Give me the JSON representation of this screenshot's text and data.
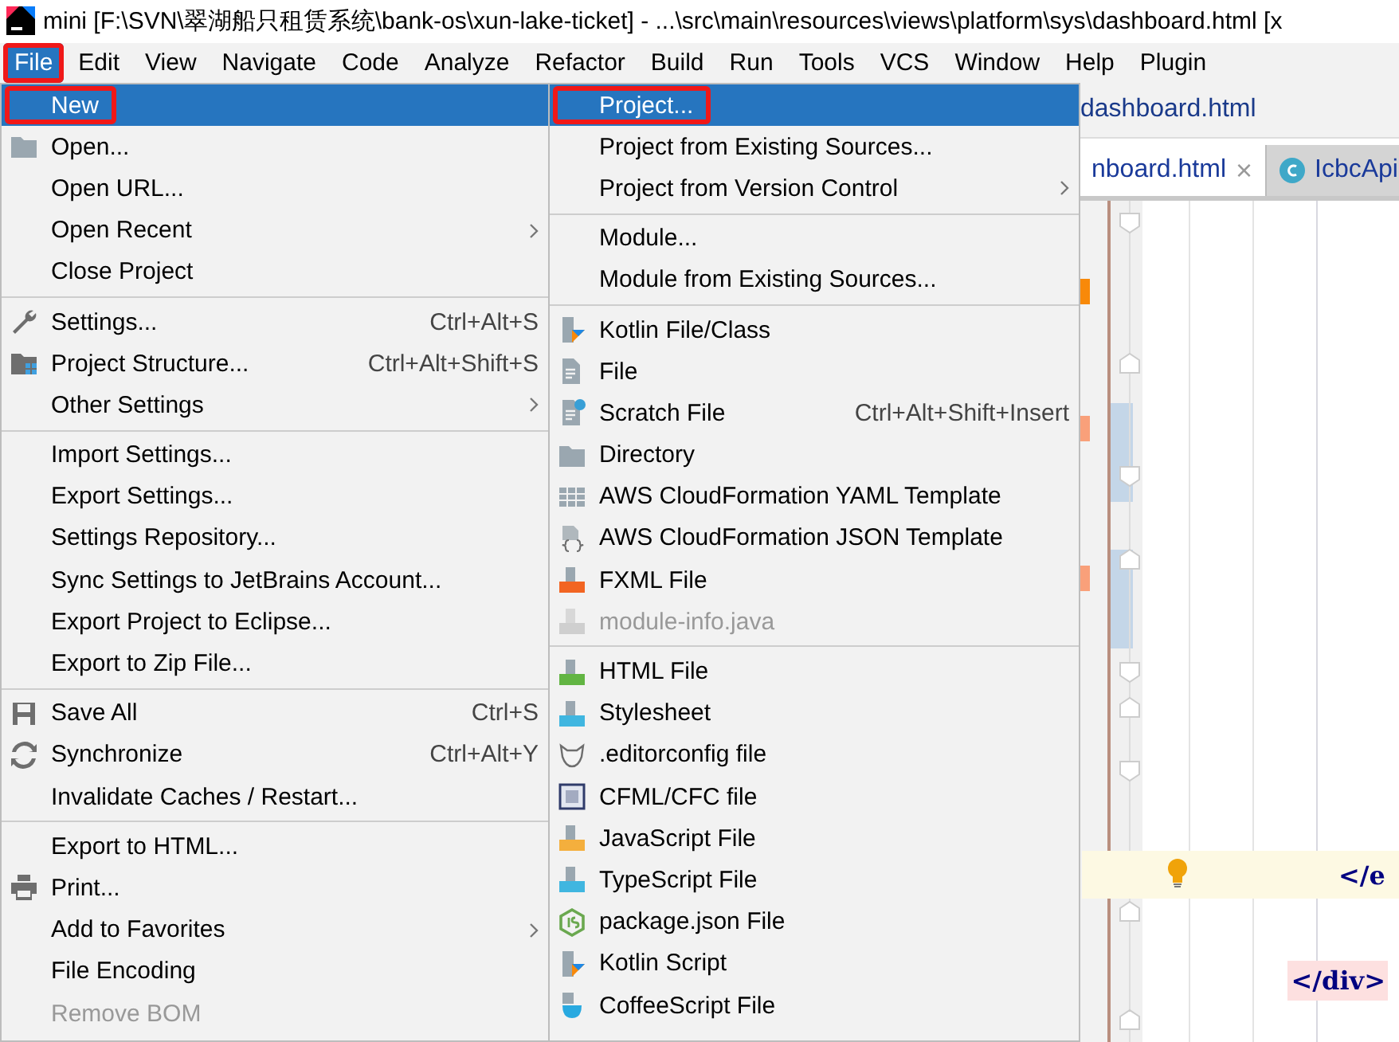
{
  "window": {
    "title": "mini [F:\\SVN\\翠湖船只租赁系统\\bank-os\\xun-lake-ticket] - ...\\src\\main\\resources\\views\\platform\\sys\\dashboard.html [x"
  },
  "menu_bar": [
    {
      "label": "File",
      "selected": true,
      "highlighted": true
    },
    {
      "label": "Edit",
      "selected": false,
      "highlighted": false
    },
    {
      "label": "View",
      "selected": false,
      "highlighted": false
    },
    {
      "label": "Navigate",
      "selected": false,
      "highlighted": false
    },
    {
      "label": "Code",
      "selected": false,
      "highlighted": false
    },
    {
      "label": "Analyze",
      "selected": false,
      "highlighted": false
    },
    {
      "label": "Refactor",
      "selected": false,
      "highlighted": false
    },
    {
      "label": "Build",
      "selected": false,
      "highlighted": false
    },
    {
      "label": "Run",
      "selected": false,
      "highlighted": false
    },
    {
      "label": "Tools",
      "selected": false,
      "highlighted": false
    },
    {
      "label": "VCS",
      "selected": false,
      "highlighted": false
    },
    {
      "label": "Window",
      "selected": false,
      "highlighted": false
    },
    {
      "label": "Help",
      "selected": false,
      "highlighted": false
    },
    {
      "label": "Plugin",
      "selected": false,
      "highlighted": false
    }
  ],
  "navigation_bar": {
    "file": "dashboard.html"
  },
  "editor_tabs": [
    {
      "label": "nboard.html",
      "close": "×",
      "selected": true
    },
    {
      "label": "IcbcApi",
      "selected": false
    }
  ],
  "editor": {
    "lines": [
      {
        "text": "</e",
        "current": true
      },
      {
        "text": "</div>",
        "current": false
      }
    ]
  },
  "file_menu": [
    {
      "kind": "item",
      "label": "New",
      "selected": true,
      "highlighted": true,
      "submenu": false,
      "disabled": false
    },
    {
      "kind": "item",
      "label": "Open...",
      "selected": false,
      "highlighted": false,
      "submenu": false,
      "disabled": false
    },
    {
      "kind": "item",
      "label": "Open URL...",
      "selected": false,
      "highlighted": false,
      "submenu": false,
      "disabled": false
    },
    {
      "kind": "item",
      "label": "Open Recent",
      "selected": false,
      "highlighted": false,
      "submenu": true,
      "disabled": false
    },
    {
      "kind": "item",
      "label": "Close Project",
      "selected": false,
      "highlighted": false,
      "submenu": false,
      "disabled": false
    },
    {
      "kind": "separator"
    },
    {
      "kind": "item",
      "label": "Settings...",
      "shortcut": "Ctrl+Alt+S",
      "selected": false,
      "highlighted": false,
      "submenu": false,
      "disabled": false
    },
    {
      "kind": "item",
      "label": "Project Structure...",
      "shortcut": "Ctrl+Alt+Shift+S",
      "selected": false,
      "highlighted": false,
      "submenu": false,
      "disabled": false
    },
    {
      "kind": "item",
      "label": "Other Settings",
      "selected": false,
      "highlighted": false,
      "submenu": true,
      "disabled": false
    },
    {
      "kind": "separator"
    },
    {
      "kind": "item",
      "label": "Import Settings...",
      "selected": false,
      "highlighted": false,
      "submenu": false,
      "disabled": false
    },
    {
      "kind": "item",
      "label": "Export Settings...",
      "selected": false,
      "highlighted": false,
      "submenu": false,
      "disabled": false
    },
    {
      "kind": "item",
      "label": "Settings Repository...",
      "selected": false,
      "highlighted": false,
      "submenu": false,
      "disabled": false
    },
    {
      "kind": "item",
      "label": "Sync Settings to JetBrains Account...",
      "selected": false,
      "highlighted": false,
      "submenu": false,
      "disabled": false
    },
    {
      "kind": "item",
      "label": "Export Project to Eclipse...",
      "selected": false,
      "highlighted": false,
      "submenu": false,
      "disabled": false
    },
    {
      "kind": "item",
      "label": "Export to Zip File...",
      "selected": false,
      "highlighted": false,
      "submenu": false,
      "disabled": false
    },
    {
      "kind": "separator"
    },
    {
      "kind": "item",
      "label": "Save All",
      "shortcut": "Ctrl+S",
      "selected": false,
      "highlighted": false,
      "submenu": false,
      "disabled": false
    },
    {
      "kind": "item",
      "label": "Synchronize",
      "shortcut": "Ctrl+Alt+Y",
      "selected": false,
      "highlighted": false,
      "submenu": false,
      "disabled": false
    },
    {
      "kind": "item",
      "label": "Invalidate Caches / Restart...",
      "selected": false,
      "highlighted": false,
      "submenu": false,
      "disabled": false
    },
    {
      "kind": "separator"
    },
    {
      "kind": "item",
      "label": "Export to HTML...",
      "selected": false,
      "highlighted": false,
      "submenu": false,
      "disabled": false
    },
    {
      "kind": "item",
      "label": "Print...",
      "selected": false,
      "highlighted": false,
      "submenu": false,
      "disabled": false
    },
    {
      "kind": "item",
      "label": "Add to Favorites",
      "selected": false,
      "highlighted": false,
      "submenu": true,
      "disabled": false
    },
    {
      "kind": "item",
      "label": "File Encoding",
      "selected": false,
      "highlighted": false,
      "submenu": false,
      "disabled": false
    },
    {
      "kind": "item",
      "label": "Remove BOM",
      "selected": false,
      "highlighted": false,
      "submenu": false,
      "disabled": true
    }
  ],
  "new_submenu": [
    {
      "kind": "item",
      "label": "Project...",
      "selected": true,
      "highlighted": true,
      "submenu": false,
      "disabled": false
    },
    {
      "kind": "item",
      "label": "Project from Existing Sources...",
      "selected": false,
      "highlighted": false,
      "submenu": false,
      "disabled": false
    },
    {
      "kind": "item",
      "label": "Project from Version Control",
      "selected": false,
      "highlighted": false,
      "submenu": true,
      "disabled": false
    },
    {
      "kind": "separator"
    },
    {
      "kind": "item",
      "label": "Module...",
      "selected": false,
      "highlighted": false,
      "submenu": false,
      "disabled": false
    },
    {
      "kind": "item",
      "label": "Module from Existing Sources...",
      "selected": false,
      "highlighted": false,
      "submenu": false,
      "disabled": false
    },
    {
      "kind": "separator"
    },
    {
      "kind": "item",
      "label": "Kotlin File/Class",
      "selected": false,
      "highlighted": false,
      "submenu": false,
      "disabled": false
    },
    {
      "kind": "item",
      "label": "File",
      "selected": false,
      "highlighted": false,
      "submenu": false,
      "disabled": false
    },
    {
      "kind": "item",
      "label": "Scratch File",
      "shortcut": "Ctrl+Alt+Shift+Insert",
      "selected": false,
      "highlighted": false,
      "submenu": false,
      "disabled": false
    },
    {
      "kind": "item",
      "label": "Directory",
      "selected": false,
      "highlighted": false,
      "submenu": false,
      "disabled": false
    },
    {
      "kind": "item",
      "label": "AWS CloudFormation YAML Template",
      "selected": false,
      "highlighted": false,
      "submenu": false,
      "disabled": false
    },
    {
      "kind": "item",
      "label": "AWS CloudFormation JSON Template",
      "selected": false,
      "highlighted": false,
      "submenu": false,
      "disabled": false
    },
    {
      "kind": "item",
      "label": "FXML File",
      "selected": false,
      "highlighted": false,
      "submenu": false,
      "disabled": false
    },
    {
      "kind": "item",
      "label": "module-info.java",
      "selected": false,
      "highlighted": false,
      "submenu": false,
      "disabled": true
    },
    {
      "kind": "separator"
    },
    {
      "kind": "item",
      "label": "HTML File",
      "selected": false,
      "highlighted": false,
      "submenu": false,
      "disabled": false
    },
    {
      "kind": "item",
      "label": "Stylesheet",
      "selected": false,
      "highlighted": false,
      "submenu": false,
      "disabled": false
    },
    {
      "kind": "item",
      "label": ".editorconfig file",
      "selected": false,
      "highlighted": false,
      "submenu": false,
      "disabled": false
    },
    {
      "kind": "item",
      "label": "CFML/CFC file",
      "selected": false,
      "highlighted": false,
      "submenu": false,
      "disabled": false
    },
    {
      "kind": "item",
      "label": "JavaScript File",
      "selected": false,
      "highlighted": false,
      "submenu": false,
      "disabled": false
    },
    {
      "kind": "item",
      "label": "TypeScript File",
      "selected": false,
      "highlighted": false,
      "submenu": false,
      "disabled": false
    },
    {
      "kind": "item",
      "label": "package.json File",
      "selected": false,
      "highlighted": false,
      "submenu": false,
      "disabled": false
    },
    {
      "kind": "item",
      "label": "Kotlin Script",
      "selected": false,
      "highlighted": false,
      "submenu": false,
      "disabled": false
    },
    {
      "kind": "item",
      "label": "CoffeeScript File",
      "selected": false,
      "highlighted": false,
      "submenu": false,
      "disabled": false
    }
  ]
}
